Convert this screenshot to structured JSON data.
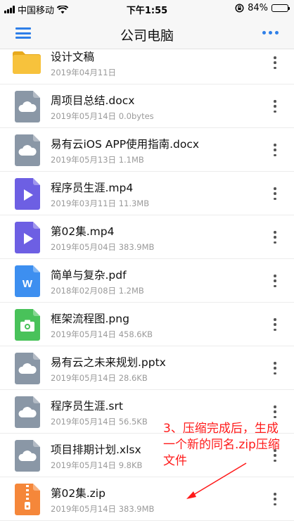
{
  "status_bar": {
    "carrier": "中国移动",
    "time": "下午1:55",
    "battery_percent": "84%",
    "battery_level": 0.84
  },
  "nav": {
    "title": "公司电脑"
  },
  "files": [
    {
      "name": "设计文稿",
      "meta": "2019年04月11日",
      "icon": "folder-icon",
      "color": "#f7c23c"
    },
    {
      "name": "周项目总结.docx",
      "meta": "2019年05月14日  0.0bytes",
      "icon": "cloud-file-icon",
      "color": "#8a97a6"
    },
    {
      "name": "易有云iOS APP使用指南.docx",
      "meta": "2019年05月13日  1.1MB",
      "icon": "cloud-file-icon",
      "color": "#8a97a6"
    },
    {
      "name": "程序员生涯.mp4",
      "meta": "2019年03月11日  11.3MB",
      "icon": "video-file-icon",
      "color": "#6d5fe3"
    },
    {
      "name": "第02集.mp4",
      "meta": "2019年05月04日  383.9MB",
      "icon": "video-file-icon",
      "color": "#6d5fe3"
    },
    {
      "name": "简单与复杂.pdf",
      "meta": "2018年02月08日  1.2MB",
      "icon": "word-file-icon",
      "color": "#3d8ff0"
    },
    {
      "name": "框架流程图.png",
      "meta": "2019年05月14日  458.6KB",
      "icon": "image-file-icon",
      "color": "#49c25a"
    },
    {
      "name": "易有云之未来规划.pptx",
      "meta": "2019年05月14日  28.6KB",
      "icon": "cloud-file-icon",
      "color": "#8a97a6"
    },
    {
      "name": "程序员生涯.srt",
      "meta": "2019年05月14日  56.5KB",
      "icon": "cloud-file-icon",
      "color": "#8a97a6"
    },
    {
      "name": "项目排期计划.xlsx",
      "meta": "2019年05月14日  9.8KB",
      "icon": "cloud-file-icon",
      "color": "#8a97a6"
    },
    {
      "name": "第02集.zip",
      "meta": "2019年05月14日  383.9MB",
      "icon": "zip-file-icon",
      "color": "#f5873a"
    }
  ],
  "annotation": {
    "text": "3、压缩完成后，生成一个新的同名.zip压缩文件",
    "color": "#ff1a1a"
  }
}
